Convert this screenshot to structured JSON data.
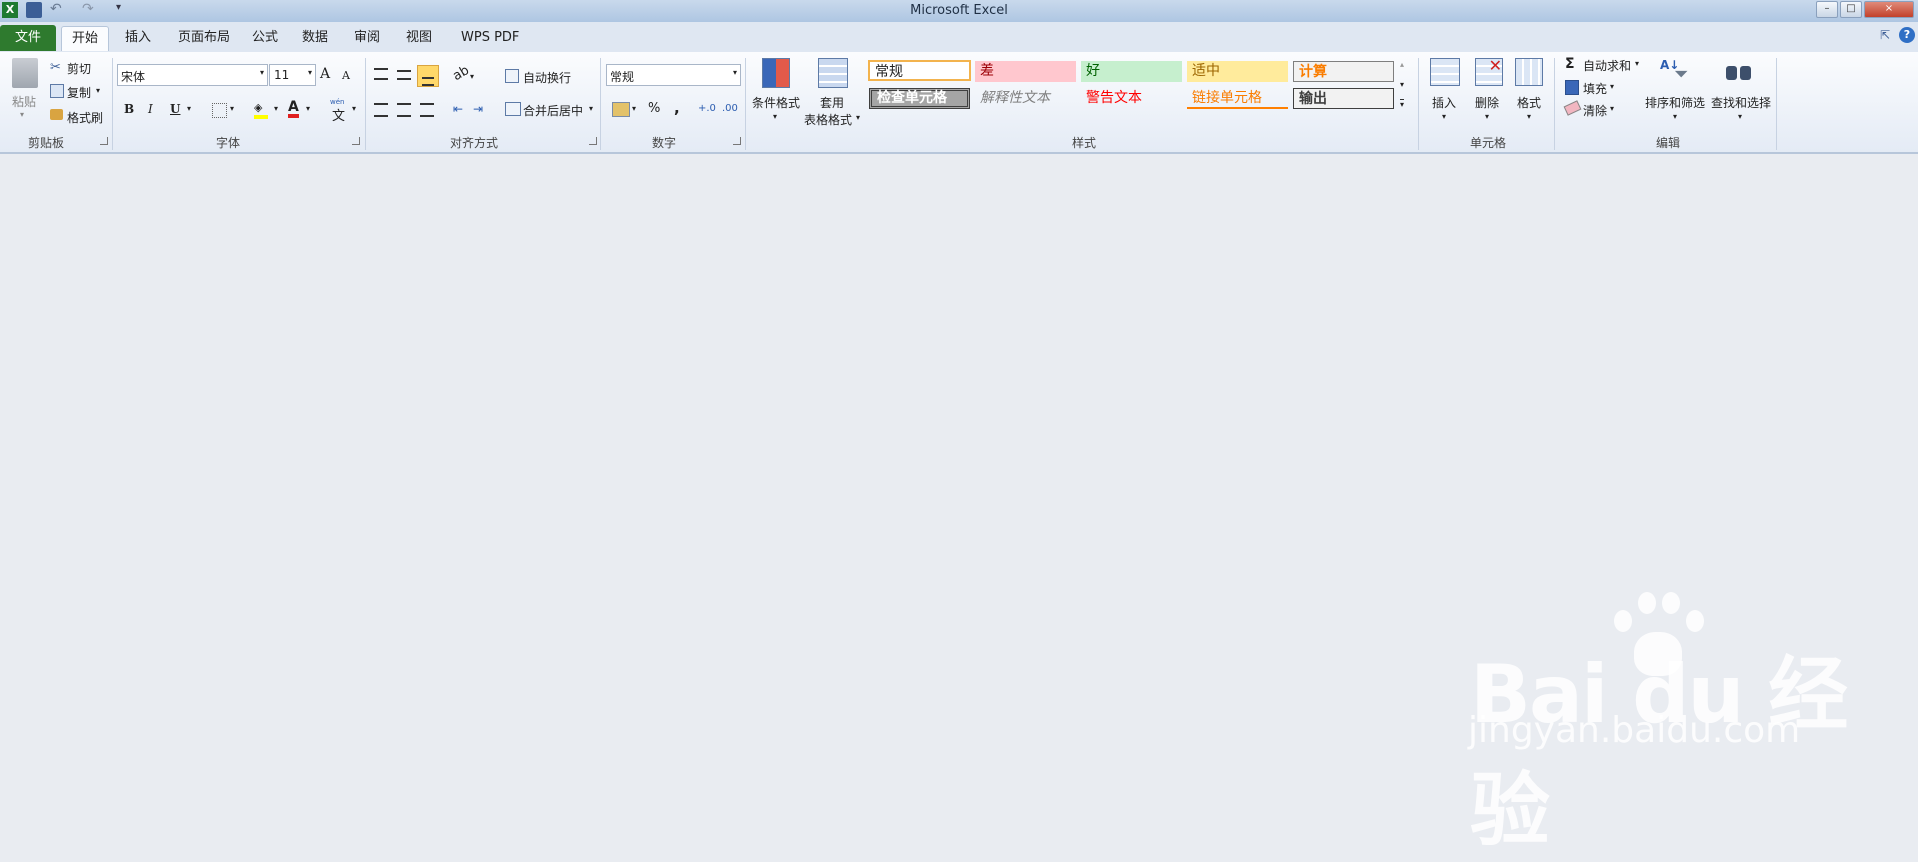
{
  "window": {
    "title": "Microsoft Excel",
    "min": "–",
    "max": "□",
    "close": "×"
  },
  "tabs": {
    "file": "文件",
    "items": [
      "开始",
      "插入",
      "页面布局",
      "公式",
      "数据",
      "审阅",
      "视图",
      "WPS PDF"
    ]
  },
  "clipboard": {
    "paste": "粘贴",
    "cut": "剪切",
    "copy": "复制",
    "format_painter": "格式刷",
    "group": "剪贴板"
  },
  "font": {
    "name": "宋体",
    "size": "11",
    "bold": "B",
    "italic": "I",
    "underline": "U",
    "grow": "A",
    "shrink": "A",
    "color_letter": "A",
    "phonetic": "wén",
    "phonetic_char": "文",
    "group": "字体"
  },
  "alignment": {
    "wrap": "自动换行",
    "merge": "合并后居中",
    "group": "对齐方式"
  },
  "number": {
    "format": "常规",
    "percent": "%",
    "comma": ",",
    "inc_decimal": "+.0",
    "dec_decimal": ".00",
    "group": "数字"
  },
  "styles": {
    "conditional": "条件格式",
    "table_line1": "套用",
    "table_line2": "表格格式",
    "cells": [
      {
        "label": "常规"
      },
      {
        "label": "差"
      },
      {
        "label": "好"
      },
      {
        "label": "适中"
      },
      {
        "label": "计算"
      },
      {
        "label": "检查单元格"
      },
      {
        "label": "解释性文本"
      },
      {
        "label": "警告文本"
      },
      {
        "label": "链接单元格"
      },
      {
        "label": "输出"
      }
    ],
    "group": "样式"
  },
  "cells": {
    "insert": "插入",
    "delete": "删除",
    "format": "格式",
    "group": "单元格"
  },
  "editing": {
    "autosum": "自动求和",
    "fill": "填充",
    "clear": "清除",
    "sort": "排序和筛选",
    "find": "查找和选择",
    "sigma": "Σ",
    "group": "编辑"
  },
  "watermark": {
    "logo": "Bai du 经验",
    "url": "jingyan.baidu.com"
  }
}
